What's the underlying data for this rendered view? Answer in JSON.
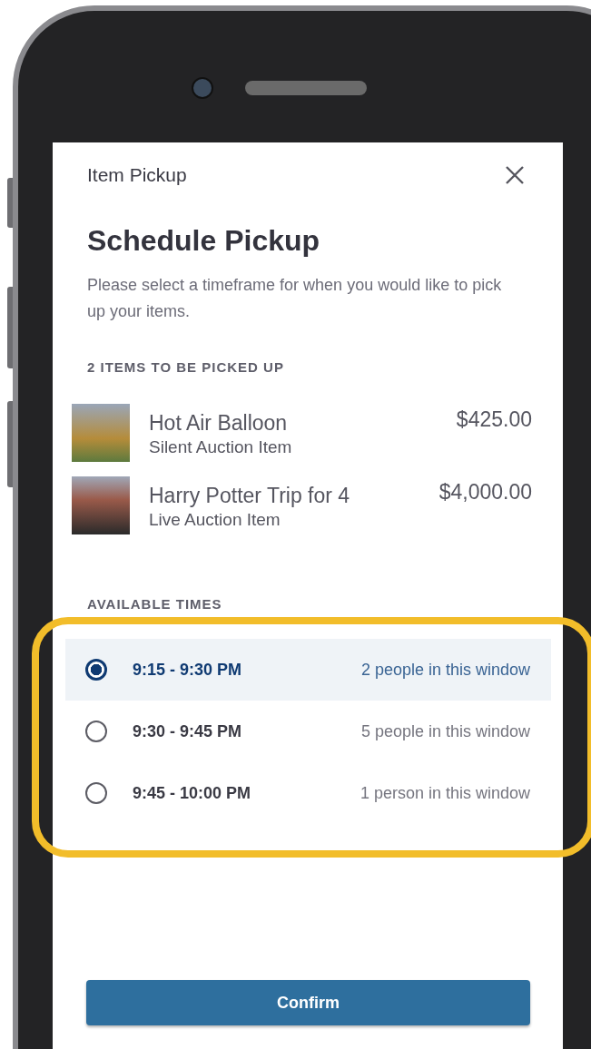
{
  "dialog": {
    "title": "Item Pickup",
    "heading": "Schedule Pickup",
    "description": "Please select a timeframe for when you would like to pick up your items."
  },
  "items_label": "2 ITEMS TO BE PICKED UP",
  "items": [
    {
      "name": "Hot Air Balloon",
      "type": "Silent Auction Item",
      "price": "$425.00"
    },
    {
      "name": "Harry Potter Trip for 4",
      "type": "Live Auction Item",
      "price": "$4,000.00"
    }
  ],
  "times_label": "AVAILABLE TIMES",
  "times": [
    {
      "time": "9:15 - 9:30 PM",
      "note": "2 people in this window",
      "selected": true
    },
    {
      "time": "9:30 - 9:45 PM",
      "note": "5 people in this window",
      "selected": false
    },
    {
      "time": "9:45 - 10:00 PM",
      "note": "1 person in this window",
      "selected": false
    }
  ],
  "confirm_button": "Confirm"
}
